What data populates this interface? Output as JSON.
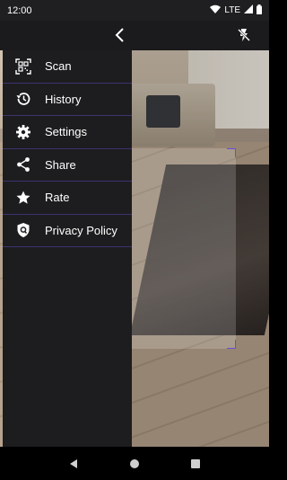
{
  "status_bar": {
    "time": "12:00",
    "network": "LTE",
    "icons": [
      "wifi-icon",
      "signal-icon",
      "battery-icon"
    ]
  },
  "toolbar": {
    "back_icon": "chevron-left-icon",
    "flash_icon": "flash-off-icon"
  },
  "drawer": {
    "items": [
      {
        "label": "Scan",
        "icon": "qr-scan-icon"
      },
      {
        "label": "History",
        "icon": "history-icon"
      },
      {
        "label": "Settings",
        "icon": "gear-icon"
      },
      {
        "label": "Share",
        "icon": "share-icon"
      },
      {
        "label": "Rate",
        "icon": "star-icon"
      },
      {
        "label": "Privacy Policy",
        "icon": "shield-icon"
      }
    ]
  },
  "nav_bar": {
    "buttons": [
      "back-triangle-icon",
      "home-circle-icon",
      "recents-square-icon"
    ]
  },
  "colors": {
    "accent": "#3c3370",
    "drawer_bg": "#1d1d1f"
  }
}
